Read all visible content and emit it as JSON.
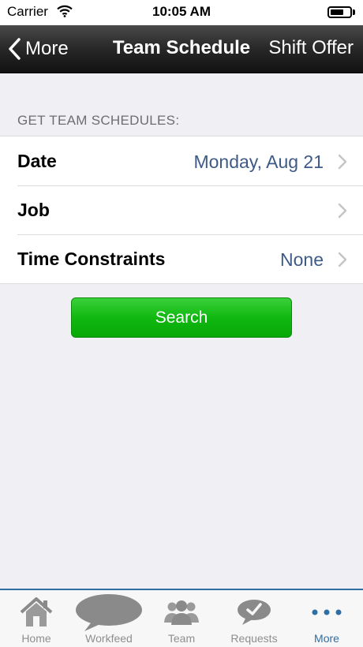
{
  "status_bar": {
    "carrier": "Carrier",
    "time": "10:05 AM"
  },
  "navbar": {
    "back_label": "More",
    "title": "Team Schedule",
    "right_label": "Shift Offer"
  },
  "section": {
    "header": "GET TEAM SCHEDULES:",
    "rows": [
      {
        "label": "Date",
        "value": "Monday, Aug 21"
      },
      {
        "label": "Job",
        "value": ""
      },
      {
        "label": "Time Constraints",
        "value": "None"
      }
    ]
  },
  "search_button": {
    "label": "Search"
  },
  "tab_bar": {
    "tabs": [
      {
        "label": "Home",
        "icon": "home-icon"
      },
      {
        "label": "Workfeed",
        "icon": "speech-bubble-icon"
      },
      {
        "label": "Team",
        "icon": "people-icon"
      },
      {
        "label": "Requests",
        "icon": "check-bubble-icon"
      },
      {
        "label": "More",
        "icon": "more-dots-icon"
      }
    ],
    "active": "More"
  },
  "colors": {
    "accent": "#2f6ea3",
    "value_text": "#3e5a86",
    "search_green": "#11b811"
  }
}
